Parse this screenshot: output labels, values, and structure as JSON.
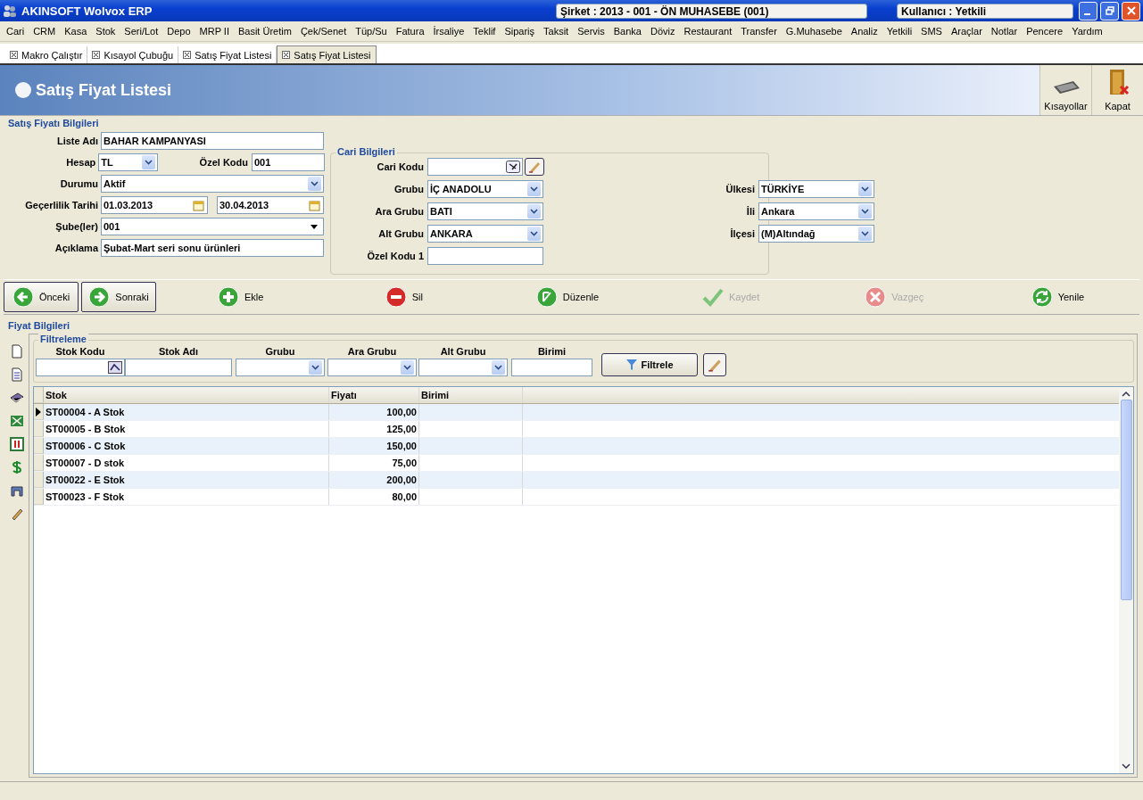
{
  "window": {
    "title": "AKINSOFT Wolvox ERP",
    "company": "Şirket : 2013 - 001 - ÖN MUHASEBE (001)",
    "user": "Kullanıcı : Yetkili"
  },
  "menu": [
    "Cari",
    "CRM",
    "Kasa",
    "Stok",
    "Seri/Lot",
    "Depo",
    "MRP II",
    "Basit Üretim",
    "Çek/Senet",
    "Tüp/Su",
    "Fatura",
    "İrsaliye",
    "Teklif",
    "Sipariş",
    "Taksit",
    "Servis",
    "Banka",
    "Döviz",
    "Restaurant",
    "Transfer",
    "G.Muhasebe",
    "Analiz",
    "Yetkili",
    "SMS",
    "Araçlar",
    "Notlar",
    "Pencere",
    "Yardım"
  ],
  "tabs": [
    {
      "label": "Makro Çalıştır",
      "selected": false
    },
    {
      "label": "Kısayol Çubuğu",
      "selected": false
    },
    {
      "label": "Satış Fiyat Listesi",
      "selected": false
    },
    {
      "label": "Satış Fiyat Listesi",
      "selected": true
    }
  ],
  "header": {
    "title": "Satış Fiyat Listesi",
    "actions": [
      {
        "kind": "shortcuts",
        "label": "Kısayollar"
      },
      {
        "kind": "close",
        "label": "Kapat"
      }
    ]
  },
  "info": {
    "title": "Satış Fiyatı Bilgileri",
    "liste_adi": {
      "label": "Liste Adı",
      "value": "BAHAR KAMPANYASI"
    },
    "hesap": {
      "label": "Hesap",
      "value": "TL"
    },
    "ozel_kodu": {
      "label": "Özel Kodu",
      "value": "001"
    },
    "durumu": {
      "label": "Durumu",
      "value": "Aktif"
    },
    "gecerlilik": {
      "label": "Geçerlilik Tarihi",
      "start": "01.03.2013",
      "end": "30.04.2013"
    },
    "subeler": {
      "label": "Şube(ler)",
      "value": "001"
    },
    "aciklama": {
      "label": "Açıklama",
      "value": "Şubat-Mart seri sonu ürünleri"
    }
  },
  "cari": {
    "title": "Cari Bilgileri",
    "cari_kodu": {
      "label": "Cari Kodu"
    },
    "left": [
      {
        "label": "Grubu",
        "value": "İÇ ANADOLU"
      },
      {
        "label": "Ara Grubu",
        "value": "BATI"
      },
      {
        "label": "Alt Grubu",
        "value": "ANKARA"
      }
    ],
    "right": [
      {
        "label": "Ülkesi",
        "value": "TÜRKİYE"
      },
      {
        "label": "İli",
        "value": "Ankara"
      },
      {
        "label": "İlçesi",
        "value": "(M)Altındağ"
      }
    ],
    "ozel_kodu_1": {
      "label": "Özel Kodu 1"
    }
  },
  "toolbar": [
    {
      "kind": "prev",
      "label": "Önceki",
      "disabled": false
    },
    {
      "kind": "next",
      "label": "Sonraki",
      "disabled": false
    },
    {
      "kind": "add",
      "label": "Ekle",
      "disabled": false
    },
    {
      "kind": "delete",
      "label": "Sil",
      "disabled": false
    },
    {
      "kind": "edit",
      "label": "Düzenle",
      "disabled": false
    },
    {
      "kind": "save",
      "label": "Kaydet",
      "disabled": true
    },
    {
      "kind": "cancel",
      "label": "Vazgeç",
      "disabled": true
    },
    {
      "kind": "refresh",
      "label": "Yenile",
      "disabled": false
    }
  ],
  "prices": {
    "title": "Fiyat Bilgileri",
    "filter": {
      "title": "Filtreleme",
      "fields": [
        {
          "label": "Stok Kodu",
          "kind": "lookup"
        },
        {
          "label": "Stok Adı",
          "kind": "text"
        },
        {
          "label": "Grubu",
          "kind": "combo"
        },
        {
          "label": "Ara Grubu",
          "kind": "combo"
        },
        {
          "label": "Alt Grubu",
          "kind": "combo"
        },
        {
          "label": "Birimi",
          "kind": "text"
        }
      ],
      "button": "Filtrele"
    },
    "table": {
      "columns": [
        "Stok",
        "Fiyatı",
        "Birimi"
      ],
      "rows": [
        {
          "stok": "ST00004 - A Stok",
          "fiyat": "100,00",
          "selected": true
        },
        {
          "stok": "ST00005 - B Stok",
          "fiyat": "125,00",
          "selected": false
        },
        {
          "stok": "ST00006 - C Stok",
          "fiyat": "150,00",
          "selected": false
        },
        {
          "stok": "ST00007 - D stok",
          "fiyat": "75,00",
          "selected": false
        },
        {
          "stok": "ST00022 - E Stok",
          "fiyat": "200,00",
          "selected": false
        },
        {
          "stok": "ST00023 - F Stok",
          "fiyat": "80,00",
          "selected": false
        }
      ]
    }
  }
}
